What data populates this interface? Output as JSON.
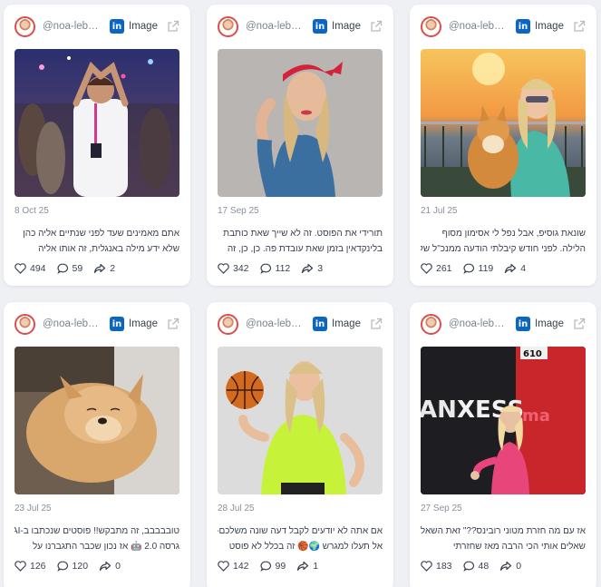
{
  "cards": [
    {
      "handle": "@noa-lebo...",
      "type": "Image",
      "date": "8 Oct 25",
      "caption": [
        "אתם מאמינים שעד לפני שנתיים אליה כהן",
        "שלא ידע מילה באנגלית, זה אותו אליה"
      ],
      "likes": "494",
      "comments": "59",
      "shares": "2"
    },
    {
      "handle": "@noa-lebo...",
      "type": "Image",
      "date": "17 Sep 25",
      "caption": [
        "תורידי את הפוסט. זה לא שייך שאת כותבת",
        "בלינקדאין בזמן שאת עובדת פה. כן, כן, זה"
      ],
      "likes": "342",
      "comments": "112",
      "shares": "3"
    },
    {
      "handle": "@noa-lebo...",
      "type": "Image",
      "date": "21 Jul 25",
      "caption": [
        "שונאת גוסיפ, אבל נפל לי אסימון מסוף",
        "הלילה. לפני חודש קיבלתי הודעה ממנכ\"ל של"
      ],
      "likes": "261",
      "comments": "119",
      "shares": "4"
    },
    {
      "handle": "@noa-lebo...",
      "type": "Image",
      "date": "23 Jul 25",
      "caption": [
        "טובבבבב, זה מתבקש!! פוסטים שנכתבו ב-AI",
        "גרסה 2.0 🤖 אז נכון שכבר התגברנו על"
      ],
      "likes": "126",
      "comments": "120",
      "shares": "0"
    },
    {
      "handle": "@noa-lebo...",
      "type": "Image",
      "date": "28 Jul 25",
      "caption": [
        "אם אתה לא יודעים לקבל דעה שונה משלכם-",
        "אל תעלו למגרש 🌍🏀 זה בכלל לא פוסט"
      ],
      "likes": "142",
      "comments": "99",
      "shares": "1"
    },
    {
      "handle": "@noa-lebo...",
      "type": "Image",
      "date": "27 Sep 25",
      "caption": [
        "אז עם מה חזרת מטוני רובינס??\" זאת השאלה'",
        "שאלים אותי הכי הרבה מאז שחזרתי"
      ],
      "likes": "183",
      "comments": "48",
      "shares": "0"
    }
  ],
  "photo_text": {
    "door_number": "610",
    "brand": "XESS",
    "brand_prefix": "AN",
    "pink_text": "ma"
  },
  "colors": {
    "linkedin": "#0a66c2",
    "avatar_ring": "#e14b4b",
    "card_bg": "#ffffff",
    "page_bg": "#eef0f4"
  },
  "icons": [
    "linkedin-icon",
    "external-link-icon",
    "heart-icon",
    "comment-icon",
    "share-icon"
  ]
}
